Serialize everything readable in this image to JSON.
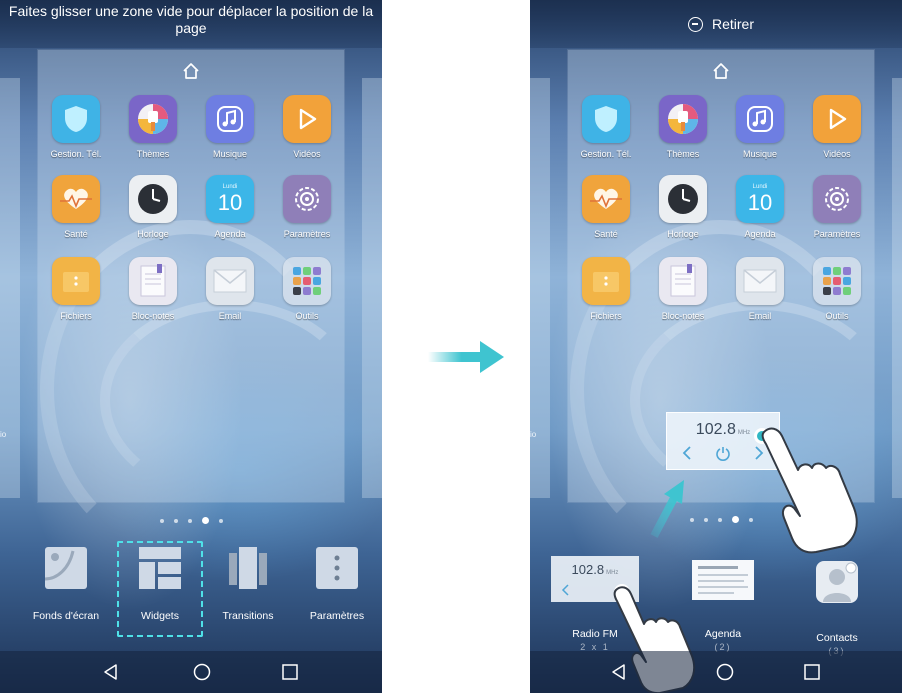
{
  "left_screen": {
    "header": "Faites glisser une zone vide pour déplacer la position de la page",
    "peek_label": "io",
    "apps": [
      {
        "label": "Gestion. Tél.",
        "icon": "shield-icon"
      },
      {
        "label": "Thèmes",
        "icon": "paintbrush-icon"
      },
      {
        "label": "Musique",
        "icon": "music-note-icon"
      },
      {
        "label": "Vidéos",
        "icon": "play-icon"
      },
      {
        "label": "Santé",
        "icon": "heart-icon"
      },
      {
        "label": "Horloge",
        "icon": "clock-icon"
      },
      {
        "label": "Agenda",
        "icon": "calendar-icon",
        "day_name": "Lundi",
        "day": "10"
      },
      {
        "label": "Paramètres",
        "icon": "gear-icon"
      },
      {
        "label": "Fichiers",
        "icon": "folder-icon"
      },
      {
        "label": "Bloc-notes",
        "icon": "notepad-icon"
      },
      {
        "label": "Email",
        "icon": "envelope-icon"
      },
      {
        "label": "Outils",
        "icon": "tools-folder-icon"
      }
    ],
    "tray": [
      {
        "label": "Fonds d'écran",
        "icon": "wallpaper-icon"
      },
      {
        "label": "Widgets",
        "icon": "widgets-icon",
        "selected": true
      },
      {
        "label": "Transitions",
        "icon": "transitions-icon"
      },
      {
        "label": "Paramètres",
        "icon": "settings-dots-icon"
      }
    ],
    "page_dots": 5,
    "active_dot": 3
  },
  "right_screen": {
    "remove_label": "Retirer",
    "peek_label": "io",
    "radio_widget": {
      "frequency": "102.8",
      "unit": "MHz"
    },
    "widget_tray": [
      {
        "label": "Radio FM",
        "sub": "2 x 1"
      },
      {
        "label": "Agenda",
        "sub": "(2)"
      },
      {
        "label": "Contacts",
        "sub": "(3)"
      }
    ],
    "mini_radio": {
      "frequency": "102.8",
      "unit": "MHz"
    }
  },
  "colors": {
    "accent_teal": "#3fc4d0",
    "highlight_dash": "#4fe1e8",
    "shield": "#3fb3e6",
    "music": "#6e7ee2",
    "video": "#f2a23a",
    "health": "#f0a43c",
    "calendar": "#3cb6e8",
    "settings": "#8f7fb8",
    "files": "#f2b446",
    "email": "#dfe5ec"
  },
  "nav": [
    "back-icon",
    "home-circle-icon",
    "recents-square-icon"
  ]
}
